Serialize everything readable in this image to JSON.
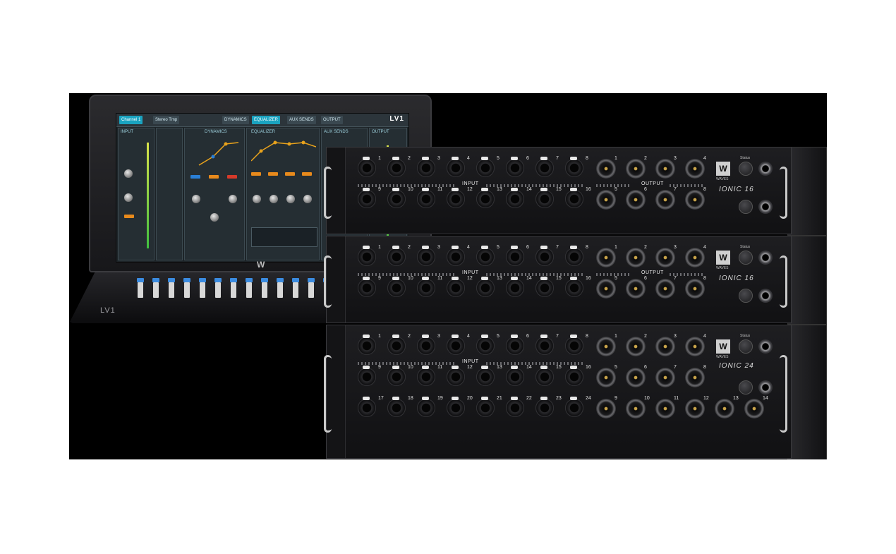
{
  "console": {
    "screen_title": "LV1",
    "tabs": [
      {
        "label": "Channel 1",
        "active": true
      },
      {
        "label": "Stereo Tmp",
        "active": false
      },
      {
        "label": "DYNAMICS",
        "active": false
      },
      {
        "label": "EQUALIZER",
        "active": true
      },
      {
        "label": "AUX SENDS",
        "active": false
      },
      {
        "label": "OUTPUT",
        "active": false
      }
    ],
    "input_label": "INPUT",
    "dynamics_label": "DYNAMICS",
    "eq_label": "EQUALIZER",
    "aux_label": "AUX SENDS",
    "output_label": "OUTPUT",
    "brand_badge": "W",
    "deck_brand": "LV1",
    "fader_count": 16
  },
  "units": [
    {
      "model": "IONIC 16",
      "logo_sub": "WAVES",
      "status_label": "Status",
      "input_label": "INPUT",
      "output_label": "OUTPUT",
      "input_rows": [
        [
          1,
          2,
          3,
          4,
          5,
          6,
          7,
          8
        ],
        [
          9,
          10,
          11,
          12,
          13,
          14,
          15,
          16
        ]
      ],
      "output_rows": [
        [
          1,
          2,
          3,
          4
        ],
        [
          5,
          6,
          7,
          8
        ]
      ]
    },
    {
      "model": "IONIC 16",
      "logo_sub": "WAVES",
      "status_label": "Status",
      "input_label": "INPUT",
      "output_label": "OUTPUT",
      "input_rows": [
        [
          1,
          2,
          3,
          4,
          5,
          6,
          7,
          8
        ],
        [
          9,
          10,
          11,
          12,
          13,
          14,
          15,
          16
        ]
      ],
      "output_rows": [
        [
          1,
          2,
          3,
          4
        ],
        [
          5,
          6,
          7,
          8
        ]
      ]
    },
    {
      "model": "IONIC 24",
      "logo_sub": "WAVES",
      "status_label": "Status",
      "input_label": "INPUT",
      "input_rows": [
        [
          1,
          2,
          3,
          4,
          5,
          6,
          7,
          8
        ],
        [
          9,
          10,
          11,
          12,
          13,
          14,
          15,
          16
        ],
        [
          17,
          18,
          19,
          20,
          21,
          22,
          23,
          24
        ]
      ],
      "output_rows": [
        [
          1,
          2,
          3,
          4
        ],
        [
          5,
          6,
          7,
          8
        ],
        [
          9,
          10,
          11,
          12,
          13,
          14
        ]
      ]
    }
  ],
  "colors": {
    "background": "#000000",
    "screen_accent": "#1aa3c0",
    "eq_curve": "#e8a21c",
    "fader_cap": "#3b8be0"
  }
}
